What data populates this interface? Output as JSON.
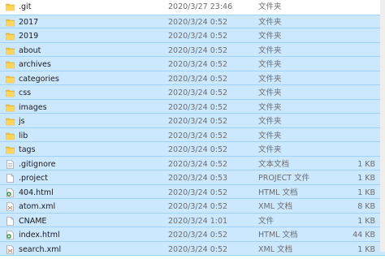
{
  "colors": {
    "selection": "#cce8ff",
    "folder": "#f4c430"
  },
  "files": [
    {
      "name": ".git",
      "date": "2020/3/27 23:46",
      "type": "文件夹",
      "size": "",
      "icon": "folder-icon",
      "selected": false
    },
    {
      "name": "2017",
      "date": "2020/3/24 0:52",
      "type": "文件夹",
      "size": "",
      "icon": "folder-icon",
      "selected": true
    },
    {
      "name": "2019",
      "date": "2020/3/24 0:52",
      "type": "文件夹",
      "size": "",
      "icon": "folder-icon",
      "selected": true
    },
    {
      "name": "about",
      "date": "2020/3/24 0:52",
      "type": "文件夹",
      "size": "",
      "icon": "folder-icon",
      "selected": true
    },
    {
      "name": "archives",
      "date": "2020/3/24 0:52",
      "type": "文件夹",
      "size": "",
      "icon": "folder-icon",
      "selected": true
    },
    {
      "name": "categories",
      "date": "2020/3/24 0:52",
      "type": "文件夹",
      "size": "",
      "icon": "folder-icon",
      "selected": true
    },
    {
      "name": "css",
      "date": "2020/3/24 0:52",
      "type": "文件夹",
      "size": "",
      "icon": "folder-icon",
      "selected": true
    },
    {
      "name": "images",
      "date": "2020/3/24 0:52",
      "type": "文件夹",
      "size": "",
      "icon": "folder-icon",
      "selected": true
    },
    {
      "name": "js",
      "date": "2020/3/24 0:52",
      "type": "文件夹",
      "size": "",
      "icon": "folder-icon",
      "selected": true
    },
    {
      "name": "lib",
      "date": "2020/3/24 0:52",
      "type": "文件夹",
      "size": "",
      "icon": "folder-icon",
      "selected": true
    },
    {
      "name": "tags",
      "date": "2020/3/24 0:52",
      "type": "文件夹",
      "size": "",
      "icon": "folder-icon",
      "selected": true
    },
    {
      "name": ".gitignore",
      "date": "2020/3/24 0:52",
      "type": "文本文档",
      "size": "1 KB",
      "icon": "text-file-icon",
      "selected": true
    },
    {
      "name": ".project",
      "date": "2020/3/24 0:53",
      "type": "PROJECT 文件",
      "size": "1 KB",
      "icon": "blank-file-icon",
      "selected": true
    },
    {
      "name": "404.html",
      "date": "2020/3/24 0:52",
      "type": "HTML 文档",
      "size": "1 KB",
      "icon": "html-file-icon",
      "selected": true
    },
    {
      "name": "atom.xml",
      "date": "2020/3/24 0:52",
      "type": "XML 文档",
      "size": "8 KB",
      "icon": "xml-file-icon",
      "selected": true
    },
    {
      "name": "CNAME",
      "date": "2020/3/24 1:01",
      "type": "文件",
      "size": "1 KB",
      "icon": "blank-file-icon",
      "selected": true
    },
    {
      "name": "index.html",
      "date": "2020/3/24 0:52",
      "type": "HTML 文档",
      "size": "44 KB",
      "icon": "html-file-icon",
      "selected": true
    },
    {
      "name": "search.xml",
      "date": "2020/3/24 0:52",
      "type": "XML 文档",
      "size": "1 KB",
      "icon": "xml-file-icon",
      "selected": true
    }
  ]
}
